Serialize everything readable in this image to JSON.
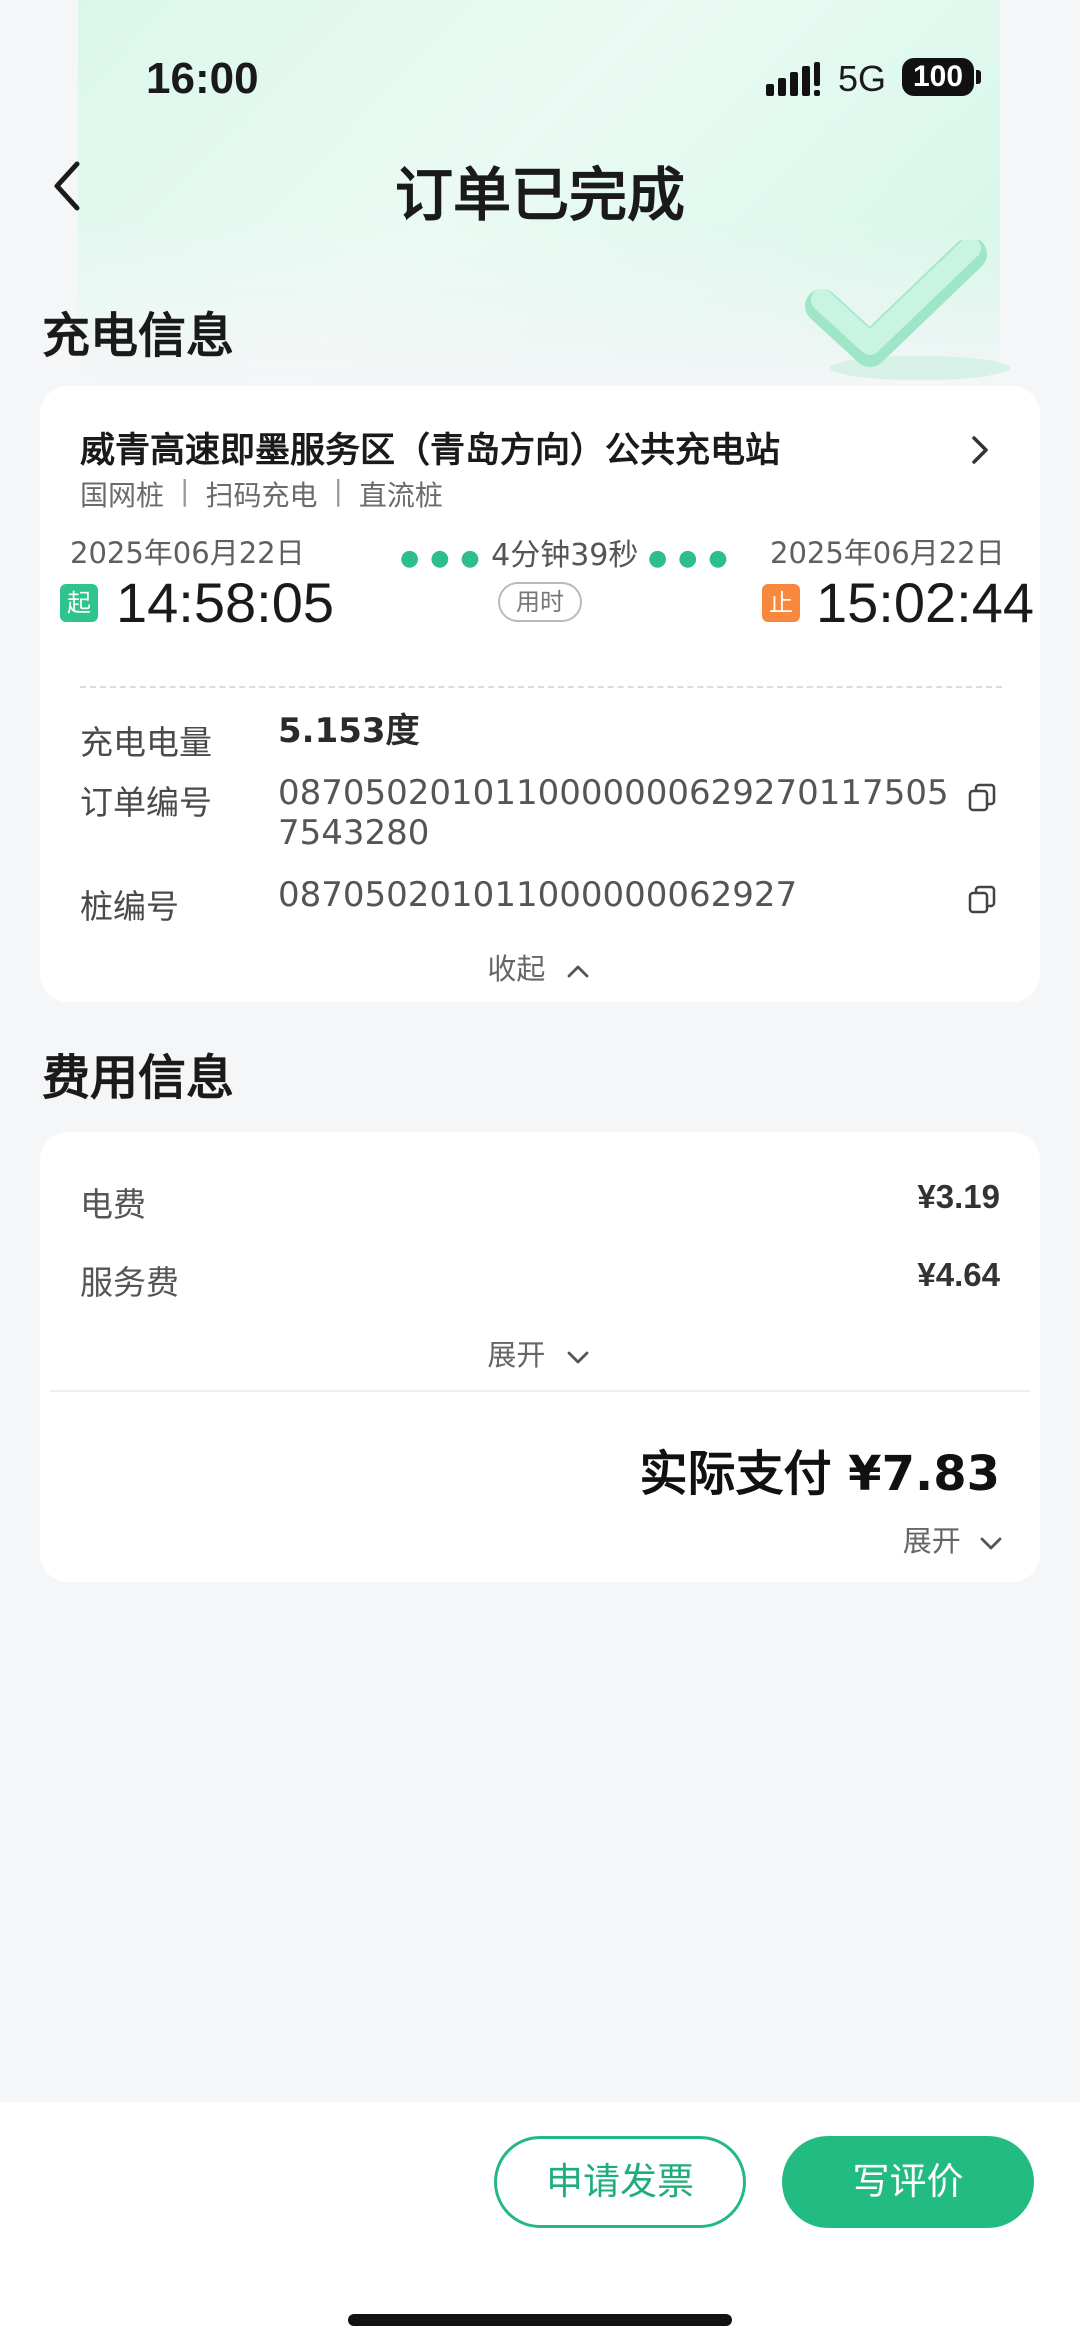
{
  "status_bar": {
    "time": "16:00",
    "network": "5G",
    "battery": "100"
  },
  "header": {
    "title": "订单已完成",
    "back_icon": "chevron-left-icon"
  },
  "charging_section": {
    "title": "充电信息",
    "station_name": "威青高速即墨服务区（青岛方向）公共充电站",
    "tags": [
      "国网桩",
      "扫码充电",
      "直流桩"
    ],
    "start_date": "2025年06月22日",
    "start_badge": "起",
    "start_time": "14:58:05",
    "duration": "4分钟39秒",
    "duration_label": "用时",
    "end_date": "2025年06月22日",
    "end_badge": "止",
    "end_time": "15:02:44",
    "rows": {
      "energy_label": "充电电量",
      "energy_value": "5.153度",
      "order_label": "订单编号",
      "order_line1": "08705020101100000006292701175​05",
      "order_line2": "7543280",
      "pile_label": "桩编号",
      "pile_value": "087050201011000000062927"
    },
    "collapse_label": "收起"
  },
  "fee_section": {
    "title": "费用信息",
    "electricity_label": "电费",
    "electricity_value": "¥3.19",
    "service_label": "服务费",
    "service_value": "¥4.64",
    "expand_label": "展开",
    "total_text": "实际支付 ¥7.83",
    "total_expand_label": "展开"
  },
  "actions": {
    "invoice_label": "申请发票",
    "review_label": "写评价"
  },
  "colors": {
    "brand_green": "#22bb82",
    "start_badge": "#2fc48d",
    "end_badge": "#f7883d"
  }
}
